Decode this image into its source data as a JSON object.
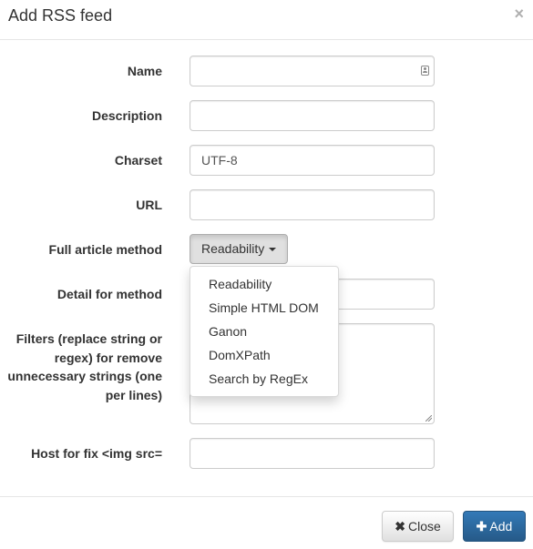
{
  "modal": {
    "title": "Add RSS feed",
    "close_symbol": "×"
  },
  "form": {
    "name_label": "Name",
    "name_value": "",
    "name_icon": "contact-card-icon",
    "description_label": "Description",
    "description_value": "",
    "charset_label": "Charset",
    "charset_value": "UTF-8",
    "url_label": "URL",
    "url_value": "",
    "method_label": "Full article method",
    "method_selected": "Readability",
    "method_options": [
      "Readability",
      "Simple HTML DOM",
      "Ganon",
      "DomXPath",
      "Search by RegEx"
    ],
    "detail_label": "Detail for method",
    "detail_value": "",
    "filters_label": "Filters (replace string or regex) for remove unnecessary strings (one per lines)",
    "filters_value": "",
    "host_label": "Host for fix <img src=",
    "host_value": ""
  },
  "footer": {
    "close_label": "Close",
    "close_icon_glyph": "✖",
    "add_label": "Add",
    "add_icon_glyph": "✚"
  },
  "colors": {
    "primary": "#337ab7",
    "primary_border": "#245580",
    "border": "#cccccc",
    "text": "#333333"
  }
}
